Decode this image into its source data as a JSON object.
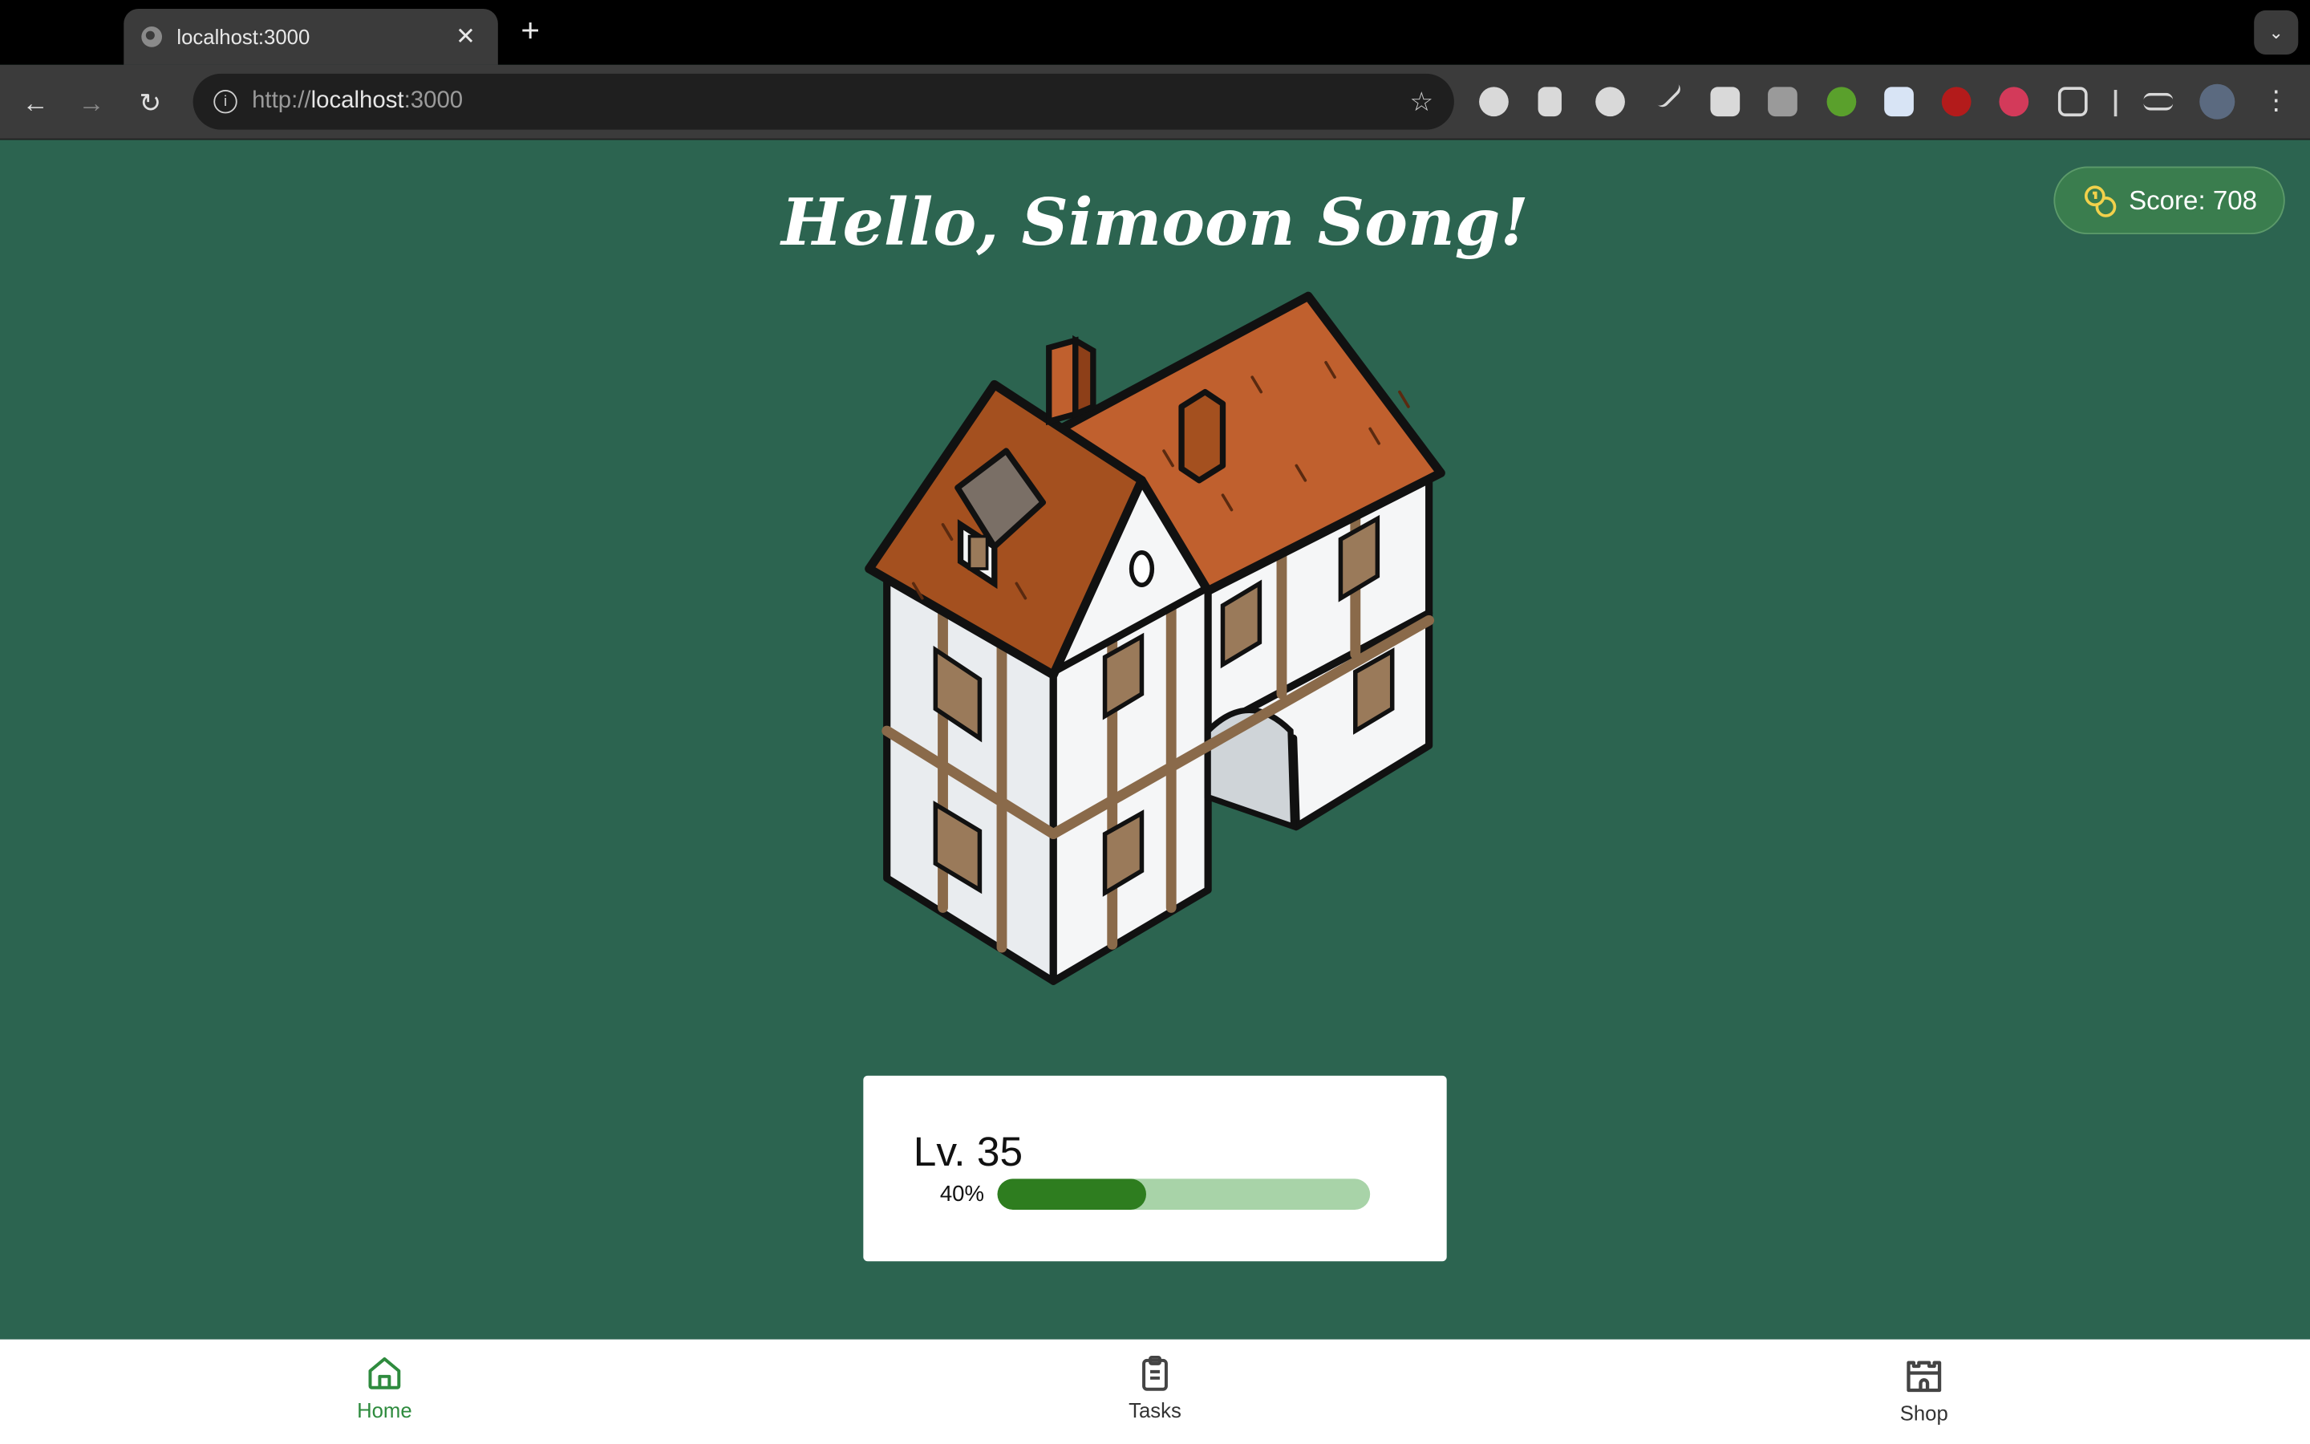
{
  "browser": {
    "tab_title": "localhost:3000",
    "url_scheme": "http://",
    "url_host": "localhost",
    "url_port": ":3000"
  },
  "app": {
    "greeting": "Hello, Simoon Song!",
    "score_label": "Score: 708",
    "level": {
      "label": "Lv. 35",
      "progress_text": "40%",
      "progress": 0.4
    }
  },
  "nav": {
    "items": [
      {
        "label": "Home",
        "icon": "home-icon",
        "active": true
      },
      {
        "label": "Tasks",
        "icon": "clipboard-icon",
        "active": false
      },
      {
        "label": "Shop",
        "icon": "castle-icon",
        "active": false
      }
    ]
  },
  "colors": {
    "background": "#2c6450",
    "accent": "#2e8b3e",
    "progress_fill": "#2e7d1f",
    "progress_track": "#a8d3a8"
  }
}
